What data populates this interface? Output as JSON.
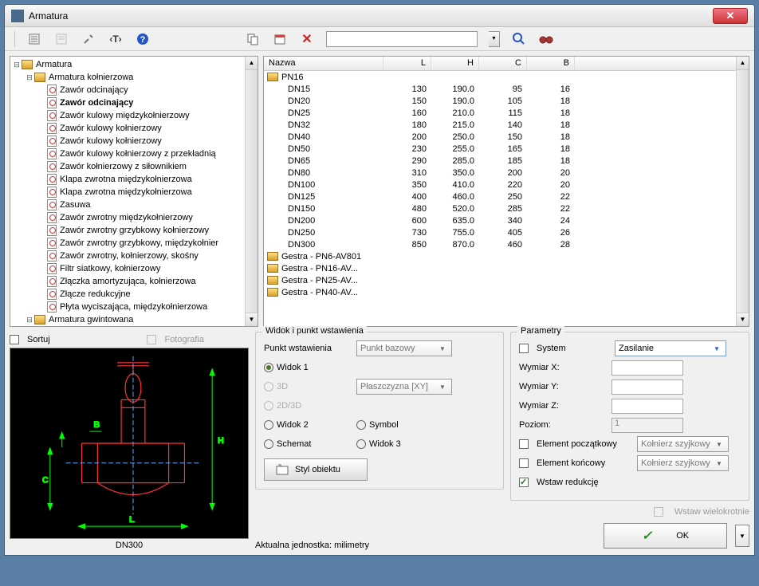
{
  "window": {
    "title": "Armatura"
  },
  "tree": {
    "root": "Armatura",
    "sub": "Armatura kołnierzowa",
    "items": [
      "Zawór odcinający",
      "Zawór odcinający",
      "Zawór kulowy międzykołnierzowy",
      "Zawór kulowy kołnierzowy",
      "Zawór kulowy kołnierzowy",
      "Zawór kulowy kołnierzowy z przekładnią",
      "Zawór kołnierzowy z siłownikiem",
      "Klapa zwrotna międzykołnierzowa",
      "Klapa zwrotna międzykołnierzowa",
      "Zasuwa",
      "Zawór zwrotny międzykołnierzowy",
      "Zawór zwrotny grzybkowy kołnierzowy",
      "Zawór zwrotny grzybkowy, międzykołnier",
      "Zawór zwrotny, kołnierzowy, skośny",
      "Filtr siatkowy, kołnierzowy",
      "Złączka amortyzująca, kołnierzowa",
      "Złącze redukcyjne",
      "Płyta wyciszająca, międzykołnierzowa"
    ],
    "sub2": "Armatura gwintowana",
    "bold_index": 1
  },
  "table": {
    "headers": {
      "name": "Nazwa",
      "l": "L",
      "h": "H",
      "c": "C",
      "b": "B"
    },
    "folder": "PN16",
    "rows": [
      {
        "name": "DN15",
        "l": "130",
        "h": "190.0",
        "c": "95",
        "b": "16"
      },
      {
        "name": "DN20",
        "l": "150",
        "h": "190.0",
        "c": "105",
        "b": "18"
      },
      {
        "name": "DN25",
        "l": "160",
        "h": "210.0",
        "c": "115",
        "b": "18"
      },
      {
        "name": "DN32",
        "l": "180",
        "h": "215.0",
        "c": "140",
        "b": "18"
      },
      {
        "name": "DN40",
        "l": "200",
        "h": "250.0",
        "c": "150",
        "b": "18"
      },
      {
        "name": "DN50",
        "l": "230",
        "h": "255.0",
        "c": "165",
        "b": "18"
      },
      {
        "name": "DN65",
        "l": "290",
        "h": "285.0",
        "c": "185",
        "b": "18"
      },
      {
        "name": "DN80",
        "l": "310",
        "h": "350.0",
        "c": "200",
        "b": "20"
      },
      {
        "name": "DN100",
        "l": "350",
        "h": "410.0",
        "c": "220",
        "b": "20"
      },
      {
        "name": "DN125",
        "l": "400",
        "h": "460.0",
        "c": "250",
        "b": "22"
      },
      {
        "name": "DN150",
        "l": "480",
        "h": "520.0",
        "c": "285",
        "b": "22"
      },
      {
        "name": "DN200",
        "l": "600",
        "h": "635.0",
        "c": "340",
        "b": "24"
      },
      {
        "name": "DN250",
        "l": "730",
        "h": "755.0",
        "c": "405",
        "b": "26"
      },
      {
        "name": "DN300",
        "l": "850",
        "h": "870.0",
        "c": "460",
        "b": "28"
      }
    ],
    "folders_after": [
      "Gestra - PN6-AV801",
      "Gestra - PN16-AV...",
      "Gestra - PN25-AV...",
      "Gestra - PN40-AV..."
    ]
  },
  "sort": {
    "label": "Sortuj",
    "photo": "Fotografia"
  },
  "preview": {
    "label": "DN300"
  },
  "mid": {
    "group": "Widok i punkt wstawienia",
    "punkt_label": "Punkt wstawienia",
    "punkt_value": "Punkt bazowy",
    "widok1": "Widok 1",
    "r3d": "3D",
    "plane": "Płaszczyzna  [XY]",
    "r2d3d": "2D/3D",
    "widok2": "Widok 2",
    "symbol": "Symbol",
    "schemat": "Schemat",
    "widok3": "Widok 3",
    "styl": "Styl obiektu",
    "unit_line": "Aktualna jednostka: milimetry"
  },
  "right": {
    "group": "Parametry",
    "system": "System",
    "system_value": "Zasilanie",
    "wx": "Wymiar X:",
    "wy": "Wymiar Y:",
    "wz": "Wymiar Z:",
    "poziom": "Poziom:",
    "poziom_value": "1",
    "elem_p": "Element początkowy",
    "elem_p_value": "Kołnierz szyjkowy",
    "elem_k": "Element końcowy",
    "elem_k_value": "Kołnierz szyjkowy",
    "wstaw_r": "Wstaw redukcję",
    "wstaw_w": "Wstaw wielokrotnie",
    "ok": "OK"
  }
}
